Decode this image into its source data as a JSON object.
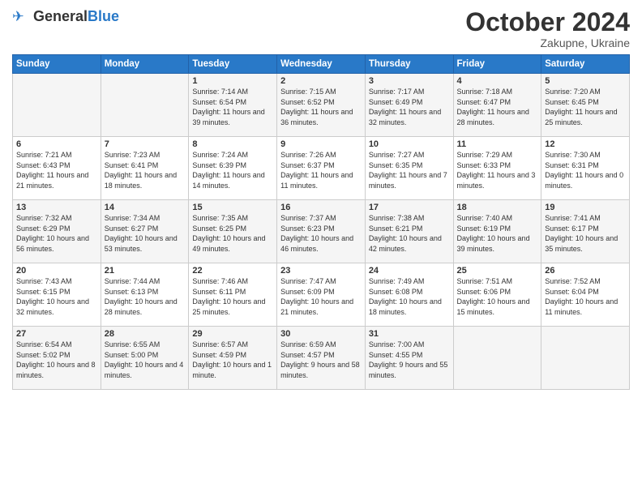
{
  "header": {
    "logo_general": "General",
    "logo_blue": "Blue",
    "month_title": "October 2024",
    "location": "Zakupne, Ukraine"
  },
  "days_of_week": [
    "Sunday",
    "Monday",
    "Tuesday",
    "Wednesday",
    "Thursday",
    "Friday",
    "Saturday"
  ],
  "weeks": [
    [
      {
        "day": "",
        "detail": ""
      },
      {
        "day": "",
        "detail": ""
      },
      {
        "day": "1",
        "detail": "Sunrise: 7:14 AM\nSunset: 6:54 PM\nDaylight: 11 hours and 39 minutes."
      },
      {
        "day": "2",
        "detail": "Sunrise: 7:15 AM\nSunset: 6:52 PM\nDaylight: 11 hours and 36 minutes."
      },
      {
        "day": "3",
        "detail": "Sunrise: 7:17 AM\nSunset: 6:49 PM\nDaylight: 11 hours and 32 minutes."
      },
      {
        "day": "4",
        "detail": "Sunrise: 7:18 AM\nSunset: 6:47 PM\nDaylight: 11 hours and 28 minutes."
      },
      {
        "day": "5",
        "detail": "Sunrise: 7:20 AM\nSunset: 6:45 PM\nDaylight: 11 hours and 25 minutes."
      }
    ],
    [
      {
        "day": "6",
        "detail": "Sunrise: 7:21 AM\nSunset: 6:43 PM\nDaylight: 11 hours and 21 minutes."
      },
      {
        "day": "7",
        "detail": "Sunrise: 7:23 AM\nSunset: 6:41 PM\nDaylight: 11 hours and 18 minutes."
      },
      {
        "day": "8",
        "detail": "Sunrise: 7:24 AM\nSunset: 6:39 PM\nDaylight: 11 hours and 14 minutes."
      },
      {
        "day": "9",
        "detail": "Sunrise: 7:26 AM\nSunset: 6:37 PM\nDaylight: 11 hours and 11 minutes."
      },
      {
        "day": "10",
        "detail": "Sunrise: 7:27 AM\nSunset: 6:35 PM\nDaylight: 11 hours and 7 minutes."
      },
      {
        "day": "11",
        "detail": "Sunrise: 7:29 AM\nSunset: 6:33 PM\nDaylight: 11 hours and 3 minutes."
      },
      {
        "day": "12",
        "detail": "Sunrise: 7:30 AM\nSunset: 6:31 PM\nDaylight: 11 hours and 0 minutes."
      }
    ],
    [
      {
        "day": "13",
        "detail": "Sunrise: 7:32 AM\nSunset: 6:29 PM\nDaylight: 10 hours and 56 minutes."
      },
      {
        "day": "14",
        "detail": "Sunrise: 7:34 AM\nSunset: 6:27 PM\nDaylight: 10 hours and 53 minutes."
      },
      {
        "day": "15",
        "detail": "Sunrise: 7:35 AM\nSunset: 6:25 PM\nDaylight: 10 hours and 49 minutes."
      },
      {
        "day": "16",
        "detail": "Sunrise: 7:37 AM\nSunset: 6:23 PM\nDaylight: 10 hours and 46 minutes."
      },
      {
        "day": "17",
        "detail": "Sunrise: 7:38 AM\nSunset: 6:21 PM\nDaylight: 10 hours and 42 minutes."
      },
      {
        "day": "18",
        "detail": "Sunrise: 7:40 AM\nSunset: 6:19 PM\nDaylight: 10 hours and 39 minutes."
      },
      {
        "day": "19",
        "detail": "Sunrise: 7:41 AM\nSunset: 6:17 PM\nDaylight: 10 hours and 35 minutes."
      }
    ],
    [
      {
        "day": "20",
        "detail": "Sunrise: 7:43 AM\nSunset: 6:15 PM\nDaylight: 10 hours and 32 minutes."
      },
      {
        "day": "21",
        "detail": "Sunrise: 7:44 AM\nSunset: 6:13 PM\nDaylight: 10 hours and 28 minutes."
      },
      {
        "day": "22",
        "detail": "Sunrise: 7:46 AM\nSunset: 6:11 PM\nDaylight: 10 hours and 25 minutes."
      },
      {
        "day": "23",
        "detail": "Sunrise: 7:47 AM\nSunset: 6:09 PM\nDaylight: 10 hours and 21 minutes."
      },
      {
        "day": "24",
        "detail": "Sunrise: 7:49 AM\nSunset: 6:08 PM\nDaylight: 10 hours and 18 minutes."
      },
      {
        "day": "25",
        "detail": "Sunrise: 7:51 AM\nSunset: 6:06 PM\nDaylight: 10 hours and 15 minutes."
      },
      {
        "day": "26",
        "detail": "Sunrise: 7:52 AM\nSunset: 6:04 PM\nDaylight: 10 hours and 11 minutes."
      }
    ],
    [
      {
        "day": "27",
        "detail": "Sunrise: 6:54 AM\nSunset: 5:02 PM\nDaylight: 10 hours and 8 minutes."
      },
      {
        "day": "28",
        "detail": "Sunrise: 6:55 AM\nSunset: 5:00 PM\nDaylight: 10 hours and 4 minutes."
      },
      {
        "day": "29",
        "detail": "Sunrise: 6:57 AM\nSunset: 4:59 PM\nDaylight: 10 hours and 1 minute."
      },
      {
        "day": "30",
        "detail": "Sunrise: 6:59 AM\nSunset: 4:57 PM\nDaylight: 9 hours and 58 minutes."
      },
      {
        "day": "31",
        "detail": "Sunrise: 7:00 AM\nSunset: 4:55 PM\nDaylight: 9 hours and 55 minutes."
      },
      {
        "day": "",
        "detail": ""
      },
      {
        "day": "",
        "detail": ""
      }
    ]
  ]
}
